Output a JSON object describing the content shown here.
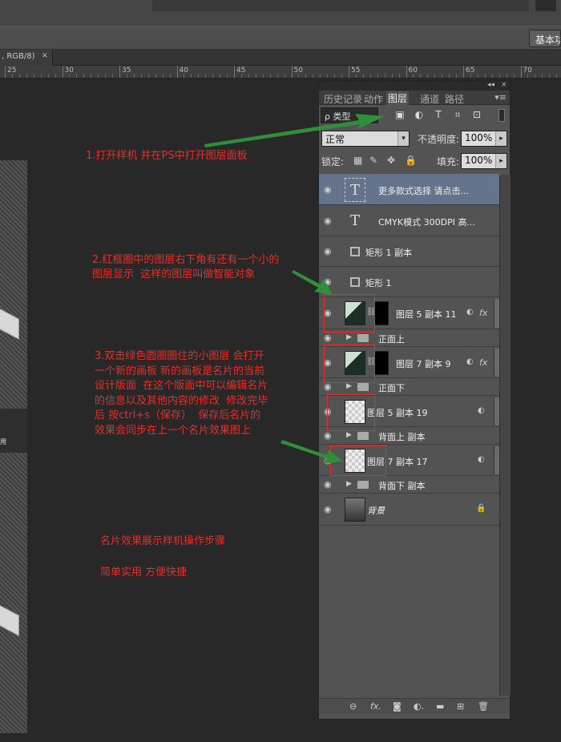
{
  "app": {
    "workspace_label": "基本功能",
    "doc_tab_label": ", RGB/8)",
    "doc_tab_close": "×"
  },
  "ruler": {
    "labels": [
      "25",
      "30",
      "35",
      "40",
      "45",
      "50",
      "55",
      "60",
      "65",
      "70"
    ]
  },
  "canvas_left": {
    "label": "用"
  },
  "annotations": {
    "step1": "1.打开样机 并在PS中打开图层面板",
    "step2": "2.红框圈中的图层右下角有还有一个小的\n图层显示  这样的图层叫做智能对象",
    "step3": "3.双击绿色圆圈圈住的小图层 会打开\n一个新的画板 新的画板是名片的当前\n设计版面  在这个版面中可以编辑名片\n的信息以及其他内容的修改  修改完毕\n后 按ctrl+s（保存）  保存后名片的\n效果会同步在上一个名片效果图上",
    "footer1": "名片效果展示样机操作步骤",
    "footer2": "简单实用 方便快捷"
  },
  "panel": {
    "head_controls": [
      "◂◂",
      "×"
    ],
    "tabs": [
      "历史记录",
      "动作",
      "图层",
      "通道",
      "路径"
    ],
    "active_tab": "图层",
    "menu_glyph": "▾≡",
    "filter_select": "ρ 类型",
    "filter_icons": [
      "▣",
      "◐",
      "T",
      "⌗",
      "⊡"
    ],
    "blend_mode": "正常",
    "opacity_label": "不透明度:",
    "opacity_value": "100%",
    "lock_label": "锁定:",
    "lock_icons": [
      "▦",
      "✎",
      "✥",
      "🔒"
    ],
    "fill_label": "填充:",
    "fill_value": "100%",
    "layers": [
      {
        "name": "更多款式选择 请点击...",
        "kind": "text",
        "selected": true
      },
      {
        "name": "CMYK模式  300DPI  高...",
        "kind": "text"
      },
      {
        "name": "矩形 1 副本",
        "kind": "shape"
      },
      {
        "name": "矩形 1",
        "kind": "shape"
      },
      {
        "name": "图层 5 副本 11",
        "kind": "smart-mask",
        "fx": "fx"
      },
      {
        "name": "正面上",
        "kind": "group"
      },
      {
        "name": "图层 7 副本 9",
        "kind": "smart-mask",
        "fx": "fx"
      },
      {
        "name": "正面下",
        "kind": "group"
      },
      {
        "name": "图层 5 副本 19",
        "kind": "smart"
      },
      {
        "name": "背面上 副本",
        "kind": "group"
      },
      {
        "name": "图层 7 副本 17",
        "kind": "smart"
      },
      {
        "name": "背面下 副本",
        "kind": "group"
      },
      {
        "name": "背景",
        "kind": "background"
      }
    ],
    "bottom_icons": [
      "⊖",
      "fx.",
      "◙",
      "◐.",
      "▬",
      "⊞",
      "🗑"
    ]
  },
  "colors": {
    "annotation": "#e2302c",
    "arrow": "#2f8f3a",
    "selected_layer": "#64748c"
  }
}
